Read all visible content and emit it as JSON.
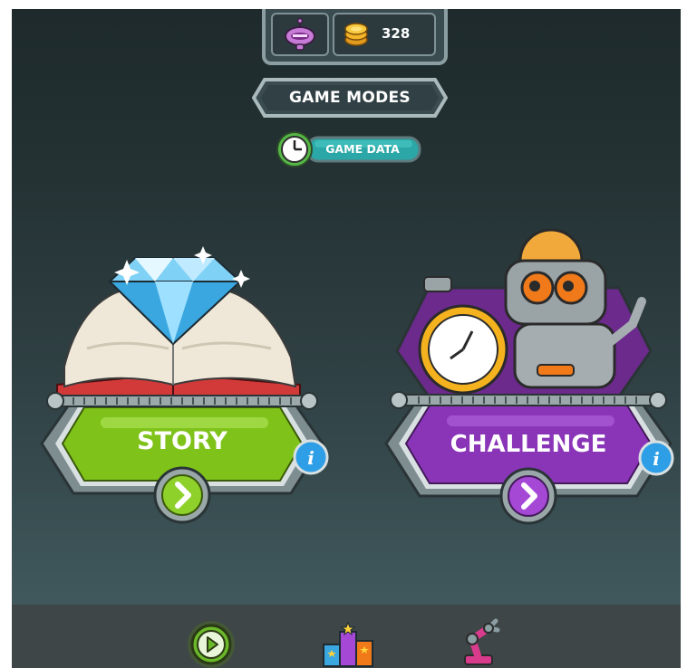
{
  "header": {
    "coin_count": "328"
  },
  "menu": {
    "game_modes_label": "GAME MODES",
    "game_data_label": "GAME DATA"
  },
  "modes": [
    {
      "id": "story",
      "label": "STORY",
      "color": "#7fc31a"
    },
    {
      "id": "challenge",
      "label": "CHALLENGE",
      "color": "#8a35b8"
    }
  ],
  "nav": {
    "items": [
      "play-icon",
      "leaderboard-icon",
      "robot-arm-icon"
    ],
    "active": "play-icon"
  },
  "colors": {
    "frame": "#8b9ea2",
    "info": "#2e9ee6",
    "teal": "#2aa7a6"
  }
}
